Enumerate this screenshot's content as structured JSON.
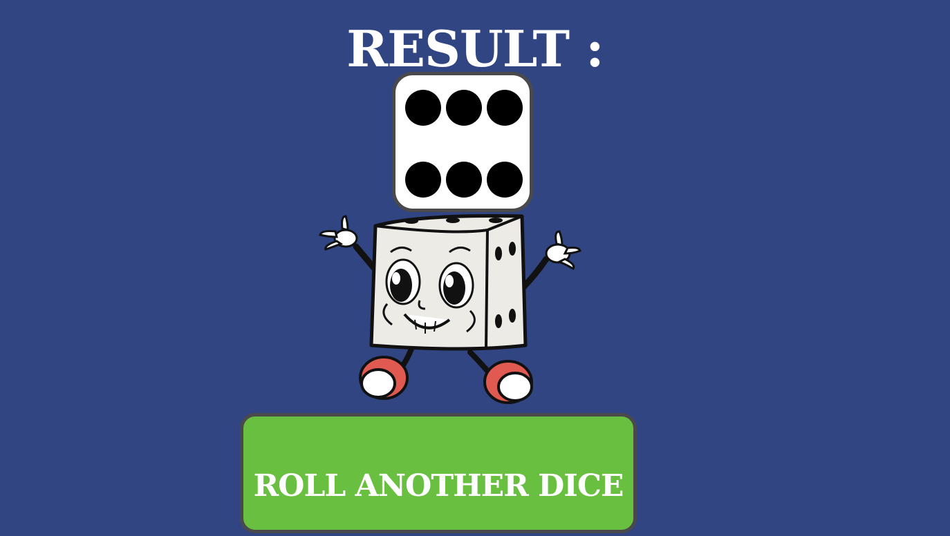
{
  "title": "RESULT :",
  "result": {
    "value": 6,
    "face_icon": "dice-six-icon"
  },
  "mascot": {
    "icon": "dice-mascot-illustration"
  },
  "button": {
    "label": "ROLL ANOTHER DICE"
  },
  "colors": {
    "background": "#304581",
    "button": "#69c040",
    "border": "#4a4a4c",
    "shoe": "#e05a52",
    "die_body": "#ecebe5"
  }
}
